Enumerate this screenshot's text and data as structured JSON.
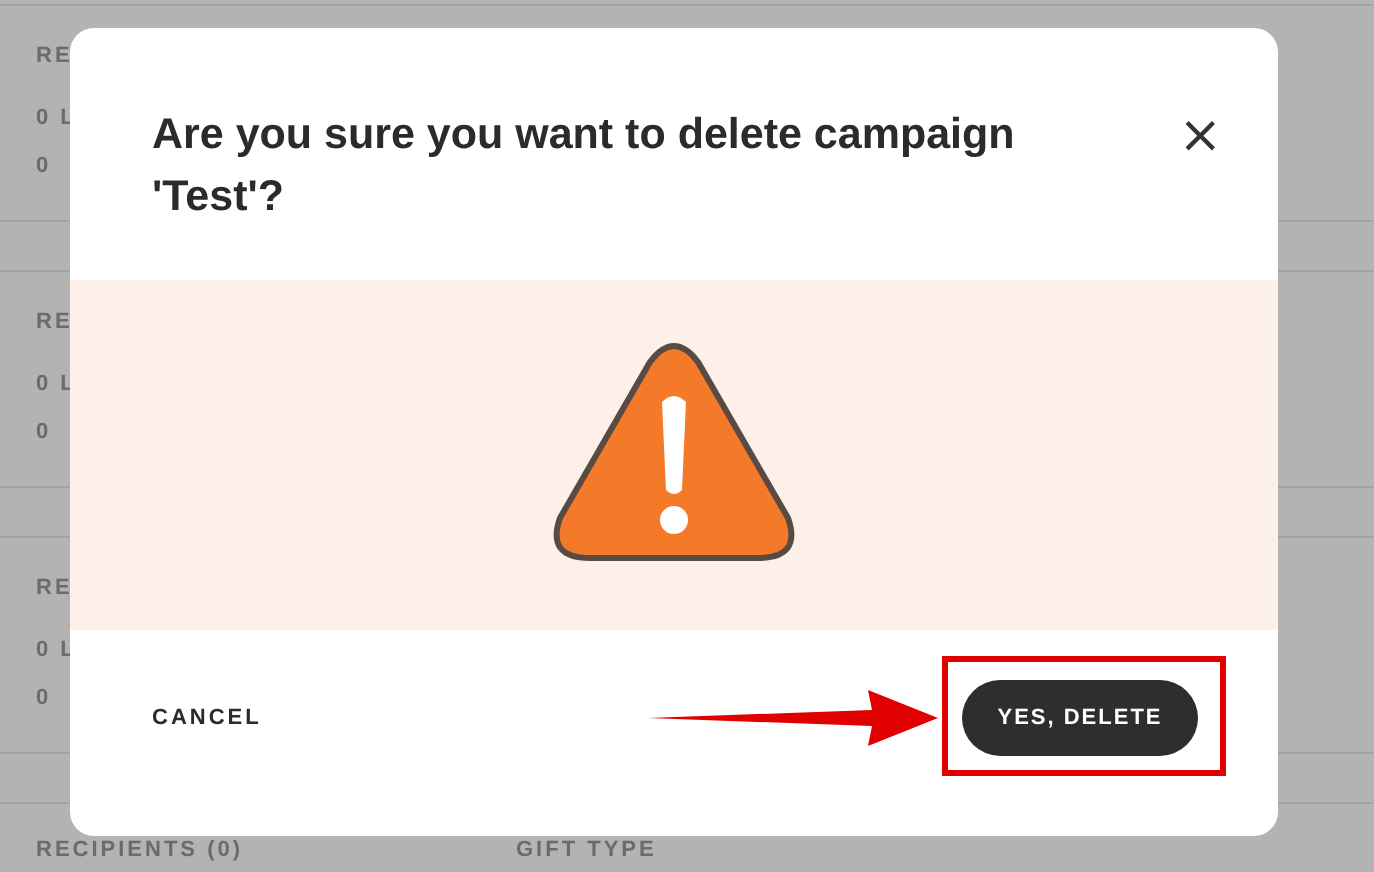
{
  "background": {
    "sections": [
      {
        "heading": "RE",
        "lines": [
          "0 L",
          "0"
        ]
      },
      {
        "heading": "RE",
        "lines": [
          "0 L",
          "0"
        ]
      },
      {
        "heading": "RE",
        "lines": [
          "0 L",
          "0"
        ]
      }
    ],
    "footer_columns": [
      "RECIPIENTS (0)",
      "GIFT TYPE"
    ]
  },
  "dialog": {
    "title": "Are you sure you want to delete campaign 'Test'?",
    "close": "×",
    "cancel": "CANCEL",
    "confirm": "YES, DELETE"
  }
}
